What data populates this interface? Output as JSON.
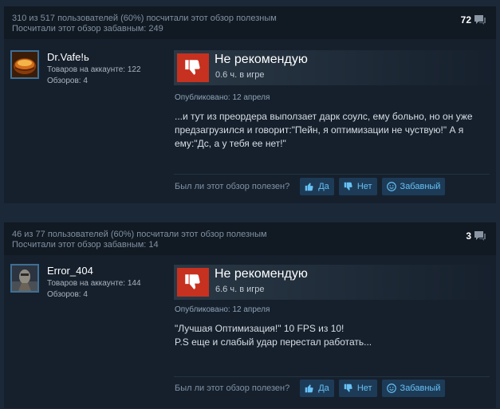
{
  "reviews": [
    {
      "helpful_summary": "310 из 517 пользователей (60%) посчитали этот обзор полезным",
      "funny_summary": "Посчитали этот обзор забавным: 249",
      "comment_count": "72",
      "author": {
        "name": "Dr.Vafe!ь",
        "products_line": "Товаров на аккаунте: 122",
        "reviews_line": "Обзоров: 4"
      },
      "recommendation": "Не рекомендую",
      "hours": "0.6 ч. в игре",
      "posted": "Опубликовано: 12 апреля",
      "body": "...и тут из преордера выползает дарк соулс, ему больно, но он уже предзагрузился и говорит:\"Пейн, я оптимизации не чуствую!\" А я ему:\"Дс, а у тебя ее нет!\"",
      "helpful_question": "Был ли этот обзор полезен?",
      "btn_yes": "Да",
      "btn_no": "Нет",
      "btn_funny": "Забавный"
    },
    {
      "helpful_summary": "46 из 77 пользователей (60%) посчитали этот обзор полезным",
      "funny_summary": "Посчитали этот обзор забавным: 14",
      "comment_count": "3",
      "author": {
        "name": "Error_404",
        "products_line": "Товаров на аккаунте: 144",
        "reviews_line": "Обзоров: 4"
      },
      "recommendation": "Не рекомендую",
      "hours": "6.6 ч. в игре",
      "posted": "Опубликовано: 12 апреля",
      "body_line1": "\"Лучшая Оптимизация!\" 10 FPS из 10!",
      "body_line2": "P.S еще и слабый удар перестал работать...",
      "helpful_question": "Был ли этот обзор полезен?",
      "btn_yes": "Да",
      "btn_no": "Нет",
      "btn_funny": "Забавный"
    }
  ],
  "icons": {
    "comment": "speech-bubble-icon",
    "thumbs_down": "thumbs-down-icon",
    "thumbs_up": "thumbs-up-icon",
    "funny": "smiley-icon"
  },
  "colors": {
    "page_bg": "#1b2838",
    "card_bg": "#16202d",
    "header_bg": "#111923",
    "not_recommended": "#c7311f",
    "button_bg": "#1d3b57",
    "button_text": "#67c1f5"
  }
}
